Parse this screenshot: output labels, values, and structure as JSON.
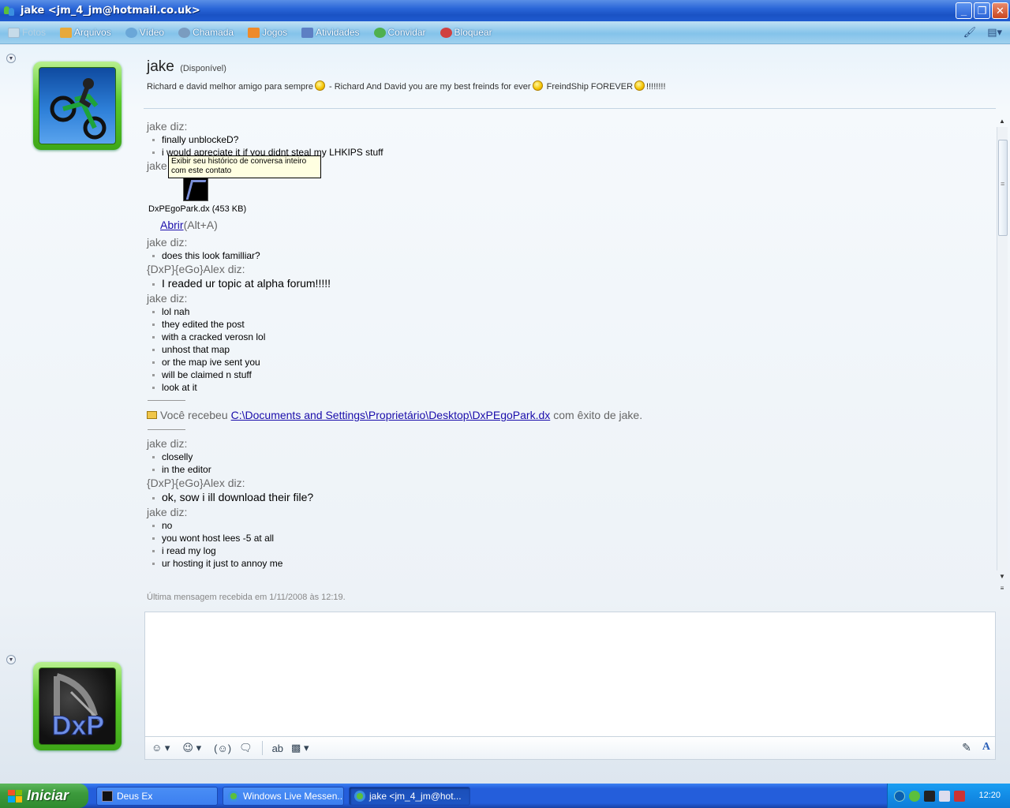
{
  "window": {
    "title": "jake <jm_4_jm@hotmail.co.uk>",
    "controls": {
      "minimize": "_",
      "maximize": "❐",
      "close": "✕"
    }
  },
  "toolbar": {
    "items": [
      {
        "label": "Fotos",
        "icon": "photos-icon",
        "disabled": true,
        "color": "#b4cfe2"
      },
      {
        "label": "Arquivos",
        "icon": "files-icon",
        "color": "#e7a93a"
      },
      {
        "label": "Vídeo",
        "icon": "video-icon",
        "color": "#6aa7d8"
      },
      {
        "label": "Chamada",
        "icon": "call-icon",
        "color": "#7a9cc0"
      },
      {
        "label": "Jogos",
        "icon": "games-icon",
        "color": "#ee8a2a"
      },
      {
        "label": "Atividades",
        "icon": "activities-icon",
        "color": "#5d7fc4"
      },
      {
        "label": "Convidar",
        "icon": "invite-icon",
        "color": "#4fb04f"
      },
      {
        "label": "Bloquear",
        "icon": "block-icon",
        "color": "#d04040"
      }
    ],
    "right_icons": [
      "paint-brush-icon",
      "menu-icon"
    ]
  },
  "contact": {
    "name": "jake",
    "status": "(Disponível)",
    "personal_message": {
      "part1": "Richard e david melhor amigo para sempre",
      "part2": " - Richard And David you are my best freinds for ever",
      "part3": " FreindShip FOREVER",
      "part4": "!!!!!!!!"
    }
  },
  "tooltip": {
    "line1": "Exibir seu histórico de conversa inteiro",
    "line2": "com este contato"
  },
  "conversation": {
    "block1": {
      "sender": "jake diz:",
      "messages": [
        "finally unblockeD?",
        "i would apreciate it if you didnt steal my LHKIPS stuff"
      ]
    },
    "file_sender": "jake",
    "file": {
      "name": "DxPEgoPark.dx (453 KB)",
      "open_link": "Abrir",
      "open_shortcut": "(Alt+A)"
    },
    "block2": {
      "sender": "jake diz:",
      "messages": [
        "does this look familliar?"
      ]
    },
    "block3": {
      "sender": "{DxP}{eGo}Alex diz:",
      "messages": [
        "I readed ur topic at alpha forum!!!!!"
      ]
    },
    "block4": {
      "sender": "jake diz:",
      "messages": [
        "lol nah",
        "they edited the post",
        "with a cracked verosn lol",
        "unhost that map",
        "or the map ive sent you",
        "will be claimed n stuff",
        "look at it"
      ]
    },
    "received": {
      "prefix": "Você recebeu",
      "path": "C:\\Documents and Settings\\Proprietário\\Desktop\\DxPEgoPark.dx",
      "suffix": "com êxito de jake."
    },
    "block5": {
      "sender": "jake diz:",
      "messages": [
        "closelly",
        "in the editor"
      ]
    },
    "block6": {
      "sender": "{DxP}{eGo}Alex diz:",
      "messages": [
        "ok, sow i ill download their file?"
      ]
    },
    "block7": {
      "sender": "jake diz:",
      "messages": [
        "no",
        "you wont host lees -5 at all",
        "i read my log",
        "ur hosting it just to annoy me"
      ]
    }
  },
  "last_message": "Última mensagem recebida em 1/11/2008 às 12:19.",
  "input_toolbar": {
    "left": [
      "emoticon-icon",
      "wink-icon",
      "nudge-icon",
      "voice-clip-icon",
      "spell-check-icon",
      "background-icon"
    ],
    "right": [
      "handwriting-icon",
      "font-icon"
    ],
    "font_label": "A"
  },
  "taskbar": {
    "start_label": "Iniciar",
    "tasks": [
      {
        "label": "Deus Ex",
        "active": false
      },
      {
        "label": "Windows Live Messen...",
        "active": false
      },
      {
        "label": "jake <jm_4_jm@hot...",
        "active": true
      }
    ],
    "clock": "12:20"
  }
}
